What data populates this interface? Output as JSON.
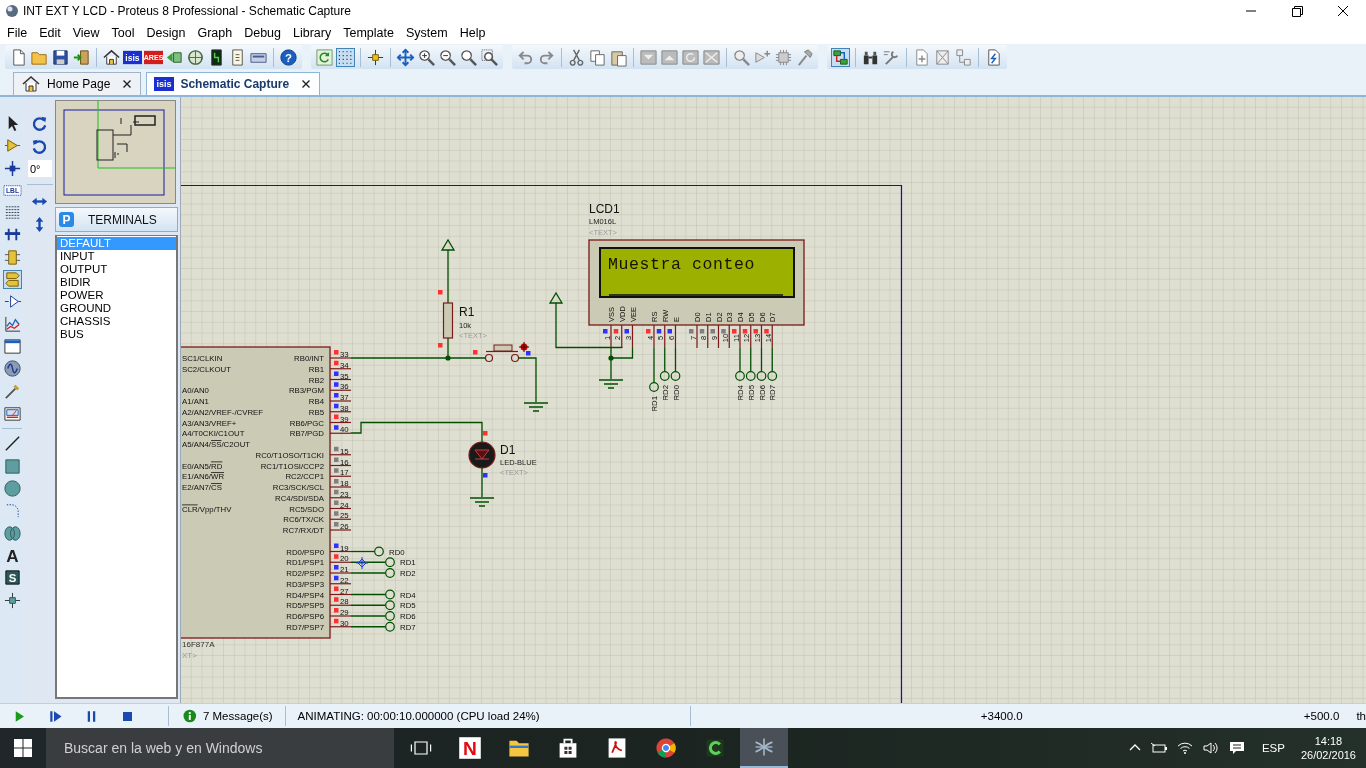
{
  "window": {
    "title": "INT EXT Y LCD - Proteus 8 Professional - Schematic Capture"
  },
  "menu": [
    "File",
    "Edit",
    "View",
    "Tool",
    "Design",
    "Graph",
    "Debug",
    "Library",
    "Template",
    "System",
    "Help"
  ],
  "toolbar": [
    [
      [
        {
          "kind": "new",
          "selected": false
        },
        {
          "kind": "open",
          "selected": false
        },
        {
          "kind": "save",
          "selected": false
        },
        {
          "kind": "import",
          "selected": false
        }
      ],
      [
        {
          "kind": "home",
          "selected": false
        },
        {
          "kind": "isis",
          "selected": false,
          "glyph": "isis"
        },
        {
          "kind": "ares",
          "selected": false,
          "glyph": "ARES"
        },
        {
          "kind": "back",
          "selected": false
        },
        {
          "kind": "view3d",
          "selected": false
        },
        {
          "kind": "gerber",
          "selected": false
        },
        {
          "kind": "bom",
          "selected": false
        },
        {
          "kind": "pcbexp",
          "selected": false
        }
      ],
      [
        {
          "kind": "help",
          "selected": false,
          "glyph": "?"
        }
      ]
    ],
    [
      [
        {
          "kind": "refresh",
          "selected": false
        },
        {
          "kind": "grid",
          "selected": true
        }
      ],
      [
        {
          "kind": "origin",
          "selected": false
        }
      ],
      [
        {
          "kind": "pan",
          "selected": false
        },
        {
          "kind": "zoomin",
          "selected": false
        },
        {
          "kind": "zoomout",
          "selected": false
        },
        {
          "kind": "zoomall",
          "selected": false
        },
        {
          "kind": "zoomarea",
          "selected": false
        }
      ]
    ],
    [
      [
        {
          "kind": "undo",
          "selected": false
        },
        {
          "kind": "redo",
          "selected": false
        }
      ],
      [
        {
          "kind": "cut",
          "selected": false
        },
        {
          "kind": "copy",
          "selected": false
        },
        {
          "kind": "paste",
          "selected": false
        }
      ],
      [
        {
          "kind": "bcopy",
          "selected": false
        },
        {
          "kind": "bmove",
          "selected": false
        },
        {
          "kind": "brot",
          "selected": false
        },
        {
          "kind": "bdel",
          "selected": false
        }
      ],
      [
        {
          "kind": "pick",
          "selected": false
        },
        {
          "kind": "mkdev",
          "selected": false
        },
        {
          "kind": "pkg",
          "selected": false
        },
        {
          "kind": "decomp",
          "selected": false
        }
      ]
    ],
    [
      [
        {
          "kind": "dexp",
          "selected": true
        }
      ],
      [
        {
          "kind": "find",
          "selected": false
        },
        {
          "kind": "prop",
          "selected": false
        }
      ],
      [
        {
          "kind": "newsheet",
          "selected": false
        },
        {
          "kind": "rmsheet",
          "selected": false
        },
        {
          "kind": "child",
          "selected": false
        }
      ],
      [
        {
          "kind": "report",
          "selected": false
        }
      ]
    ]
  ],
  "tabs": [
    {
      "label": "Home Page",
      "kind": "home",
      "selected": false
    },
    {
      "label": "Schematic Capture",
      "kind": "isis",
      "glyph": "isis",
      "selected": true
    }
  ],
  "tools": [
    {
      "kind": "pointer",
      "selected": false
    },
    {
      "kind": "component",
      "selected": false
    },
    {
      "kind": "junction",
      "selected": false
    },
    {
      "kind": "label",
      "glyph": "LBL",
      "selected": false
    },
    {
      "kind": "script",
      "selected": false
    },
    {
      "kind": "bus",
      "selected": false
    },
    {
      "kind": "subckt",
      "selected": false
    },
    {
      "kind": "terminal",
      "selected": true
    },
    {
      "kind": "port",
      "selected": false
    },
    {
      "kind": "graph",
      "selected": false
    },
    {
      "kind": "window",
      "selected": false
    },
    {
      "kind": "generator",
      "selected": false
    },
    {
      "kind": "probe",
      "selected": false
    },
    {
      "kind": "instrument",
      "selected": false
    },
    {
      "kind": "line",
      "selected": false
    },
    {
      "kind": "box",
      "selected": false
    },
    {
      "kind": "circle",
      "selected": false
    },
    {
      "kind": "arc",
      "selected": false
    },
    {
      "kind": "path",
      "selected": false
    },
    {
      "kind": "text",
      "glyph": "A",
      "selected": false
    },
    {
      "kind": "symbol",
      "glyph": "S",
      "selected": false
    },
    {
      "kind": "marker",
      "selected": false
    }
  ],
  "orientation": {
    "angle": "0°",
    "buttons": [
      {
        "kind": "rotcw"
      },
      {
        "kind": "rotccw"
      },
      {
        "kind": "mirrorh"
      },
      {
        "kind": "mirrorv"
      }
    ]
  },
  "terminals_panel": {
    "badge": "P",
    "title": "TERMINALS",
    "items": [
      {
        "label": "DEFAULT",
        "selected": true
      },
      {
        "label": "INPUT",
        "selected": false
      },
      {
        "label": "OUTPUT",
        "selected": false
      },
      {
        "label": "BIDIR",
        "selected": false
      },
      {
        "label": "POWER",
        "selected": false
      },
      {
        "label": "GROUND",
        "selected": false
      },
      {
        "label": "CHASSIS",
        "selected": false
      },
      {
        "label": "BUS",
        "selected": false
      }
    ]
  },
  "schematic": {
    "mcu": {
      "part": "16F877A",
      "text": "XT>",
      "left_pins": [
        {
          "parts": [
            {
              "text": "SC1/CLKIN",
              "overline": false
            }
          ]
        },
        {
          "parts": [
            {
              "text": "SC2/CLKOUT",
              "overline": false
            }
          ]
        },
        {
          "parts": [
            {
              "text": "A0/AN0",
              "overline": false
            }
          ]
        },
        {
          "parts": [
            {
              "text": "A1/AN1",
              "overline": false
            }
          ]
        },
        {
          "parts": [
            {
              "text": "A2/AN2/VREF-/CVREF",
              "overline": false
            }
          ]
        },
        {
          "parts": [
            {
              "text": "A3/AN3/VREF+",
              "overline": false
            }
          ]
        },
        {
          "parts": [
            {
              "text": "A4/T0CKI/C1OUT",
              "overline": false
            }
          ]
        },
        {
          "parts": [
            {
              "text": "A5/AN4/",
              "overline": false
            },
            {
              "text": "SS",
              "overline": true
            },
            {
              "text": "/C2OUT",
              "overline": false
            }
          ]
        },
        {
          "parts": [
            {
              "text": "E0/AN5/",
              "overline": false
            },
            {
              "text": "RD",
              "overline": true
            }
          ]
        },
        {
          "parts": [
            {
              "text": "E1/AN6/",
              "overline": false
            },
            {
              "text": "WR",
              "overline": true
            }
          ]
        },
        {
          "parts": [
            {
              "text": "E2/AN7/",
              "overline": false
            },
            {
              "text": "CS",
              "overline": true
            }
          ]
        },
        {
          "parts": [
            {
              "text": "CLR",
              "overline": true
            },
            {
              "text": "/Vpp/THV",
              "overline": false
            }
          ]
        }
      ],
      "right_pins": [
        {
          "label": "RB0/INT",
          "number": "33",
          "color": "#ff3030"
        },
        {
          "label": "RB1",
          "number": "34",
          "color": "#ff3030"
        },
        {
          "label": "RB2",
          "number": "35",
          "color": "#3030ff"
        },
        {
          "label": "RB3/PGM",
          "number": "36",
          "color": "#3030ff"
        },
        {
          "label": "RB4",
          "number": "37",
          "color": "#3030ff"
        },
        {
          "label": "RB5",
          "number": "38",
          "color": "#3030ff"
        },
        {
          "label": "RB6/PGC",
          "number": "39",
          "color": "#ff3030"
        },
        {
          "label": "RB7/PGD",
          "number": "40",
          "color": "#3030ff"
        },
        {
          "label": "RC0/T1OSO/T1CKI",
          "number": "15",
          "color": "#808080"
        },
        {
          "label": "RC1/T1OSI/CCP2",
          "number": "16",
          "color": "#808080"
        },
        {
          "label": "RC2/CCP1",
          "number": "17",
          "color": "#808080"
        },
        {
          "label": "RC3/SCK/SCL",
          "number": "18",
          "color": "#808080"
        },
        {
          "label": "RC4/SDI/SDA",
          "number": "23",
          "color": "#808080"
        },
        {
          "label": "RC5/SDO",
          "number": "24",
          "color": "#808080"
        },
        {
          "label": "RC6/TX/CK",
          "number": "25",
          "color": "#808080"
        },
        {
          "label": "RC7/RX/DT",
          "number": "26",
          "color": "#808080"
        },
        {
          "label": "RD0/PSP0",
          "number": "19",
          "color": "#3030ff"
        },
        {
          "label": "RD1/PSP1",
          "number": "20",
          "color": "#ff3030"
        },
        {
          "label": "RD2/PSP2",
          "number": "21",
          "color": "#3030ff"
        },
        {
          "label": "RD3/PSP3",
          "number": "22",
          "color": "#3030ff"
        },
        {
          "label": "RD4/PSP4",
          "number": "27",
          "color": "#ff3030"
        },
        {
          "label": "RD5/PSP5",
          "number": "28",
          "color": "#ff3030"
        },
        {
          "label": "RD6/PSP6",
          "number": "29",
          "color": "#ff3030"
        },
        {
          "label": "RD7/PSP7",
          "number": "30",
          "color": "#ff3030"
        }
      ],
      "terminals": [
        "RD0",
        "RD1",
        "RD2",
        "RD4",
        "RD5",
        "RD6",
        "RD7"
      ]
    },
    "lcd": {
      "name": "LCD1",
      "part": "LM016L",
      "text": "<TEXT>",
      "line1": "Muestra conteo",
      "pins": [
        {
          "label": "VSS",
          "number": "1",
          "color": "#3030ff"
        },
        {
          "label": "VDD",
          "number": "2",
          "color": "#ff3030"
        },
        {
          "label": "VEE",
          "number": "3",
          "color": "#3030ff"
        },
        {
          "label": "RS",
          "number": "4",
          "color": "#ff3030"
        },
        {
          "label": "RW",
          "number": "5",
          "color": "#3030ff"
        },
        {
          "label": "E",
          "number": "6",
          "color": "#3030ff"
        },
        {
          "label": "D0",
          "number": "7",
          "color": "#808080"
        },
        {
          "label": "D1",
          "number": "8",
          "color": "#808080"
        },
        {
          "label": "D2",
          "number": "9",
          "color": "#808080"
        },
        {
          "label": "D3",
          "number": "10",
          "color": "#808080"
        },
        {
          "label": "D4",
          "number": "11",
          "color": "#ff3030"
        },
        {
          "label": "D5",
          "number": "12",
          "color": "#ff3030"
        },
        {
          "label": "D6",
          "number": "13",
          "color": "#ff3030"
        },
        {
          "label": "D7",
          "number": "14",
          "color": "#ff3030"
        }
      ],
      "terminals": [
        "RD1",
        "RD2",
        "RD0",
        "RD4",
        "RD5",
        "RD6",
        "RD7"
      ]
    },
    "resistor": {
      "name": "R1",
      "value": "10k",
      "text": "<TEXT>",
      "pins": [
        {
          "color": "#ff3030"
        },
        {
          "color": "#ff3030"
        }
      ]
    },
    "switch": {
      "pins": [
        {
          "color": "#ff3030"
        },
        {
          "color": "#3030ff"
        }
      ]
    },
    "led": {
      "name": "D1",
      "part": "LED-BLUE",
      "text": "<TEXT>",
      "lit": false,
      "pins": [
        {
          "color": "#ff3030"
        },
        {
          "color": "#3030ff"
        }
      ]
    }
  },
  "sim_controls": [
    {
      "kind": "play"
    },
    {
      "kind": "step"
    },
    {
      "kind": "pause"
    },
    {
      "kind": "stop"
    }
  ],
  "status_bar": {
    "messages": "7 Message(s)",
    "status": "ANIMATING: 00:00:10.000000 (CPU load 24%)",
    "x": "+3400.0",
    "y": "+500.0",
    "unit": "th"
  },
  "taskbar": {
    "search_placeholder": "Buscar en la web y en Windows",
    "apps": [
      {
        "kind": "taskview",
        "selected": false
      },
      {
        "kind": "netflix",
        "glyph": "N",
        "selected": false
      },
      {
        "kind": "explorer",
        "selected": false
      },
      {
        "kind": "store",
        "selected": false
      },
      {
        "kind": "pdf",
        "selected": false
      },
      {
        "kind": "chrome",
        "selected": false
      },
      {
        "kind": "greenapp",
        "selected": false
      },
      {
        "kind": "proteus",
        "selected": true
      }
    ],
    "language": "ESP",
    "time": "14:18",
    "date": "26/02/2016"
  }
}
